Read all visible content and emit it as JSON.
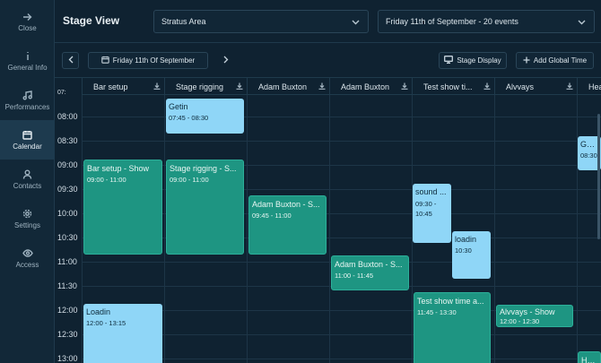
{
  "sidebar": {
    "items": [
      {
        "label": "Close",
        "icon": "arrow-right-icon"
      },
      {
        "label": "General Info",
        "icon": "info-icon"
      },
      {
        "label": "Performances",
        "icon": "music-note-icon"
      },
      {
        "label": "Calendar",
        "icon": "calendar-icon",
        "active": true
      },
      {
        "label": "Contacts",
        "icon": "user-icon"
      },
      {
        "label": "Settings",
        "icon": "gear-icon"
      },
      {
        "label": "Access",
        "icon": "eye-icon"
      }
    ]
  },
  "header": {
    "title": "Stage View",
    "area_select": "Stratus Area",
    "date_select": "Friday 11th of September - 20 events"
  },
  "toolbar": {
    "date_label": "Friday 11th Of September",
    "stage_display_label": "Stage Display",
    "add_global_time_label": "Add Global Time"
  },
  "columns": [
    "Bar setup",
    "Stage rigging",
    "Adam Buxton",
    "Adam Buxton",
    "Test show ti...",
    "Alvvays",
    "Hea"
  ],
  "times": [
    "07:",
    "08:00",
    "08:30",
    "09:00",
    "09:30",
    "10:00",
    "10:30",
    "11:00",
    "11:30",
    "12:00",
    "12:30",
    "13:00"
  ],
  "events": [
    {
      "title": "Getin",
      "time": "07:45 - 08:30"
    },
    {
      "title": "Bar setup - Show",
      "time": "09:00 - 11:00"
    },
    {
      "title": "Stage rigging - S...",
      "time": "09:00 - 11:00"
    },
    {
      "title": "Adam Buxton - S...",
      "time": "09:45 - 11:00"
    },
    {
      "title": "sound ...",
      "time": "09:30 - 10:45"
    },
    {
      "title": "loadin",
      "time": "10:30"
    },
    {
      "title": "Adam Buxton - S...",
      "time": "11:00 - 11:45"
    },
    {
      "title": "Test show time a...",
      "time": "11:45 - 13:30"
    },
    {
      "title": "Alvvays - Show",
      "time": "12:00 - 12:30"
    },
    {
      "title": "Loadin",
      "time": "12:00 - 13:15"
    },
    {
      "title": "Getin",
      "time": "08:30"
    },
    {
      "title": "Head",
      "time": ""
    }
  ],
  "colors": {
    "background": "#0f2231",
    "event_blue": "#8fd6f7",
    "event_green": "#1e9582"
  }
}
